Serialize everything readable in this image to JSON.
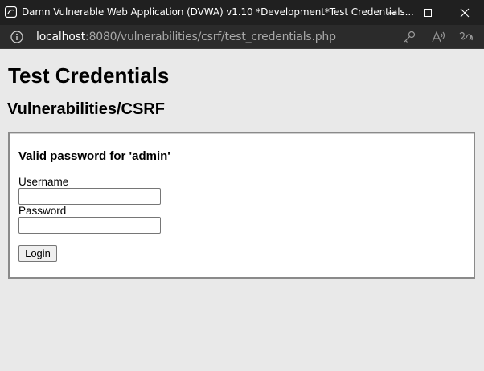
{
  "window": {
    "title": "Damn Vulnerable Web Application (DVWA) v1.10 *Development*Test Credentials...",
    "app_icon": "dvwa-app-icon",
    "controls": [
      "minimize-icon",
      "maximize-icon",
      "close-icon"
    ]
  },
  "address_bar": {
    "host": "localhost",
    "path": ":8080/vulnerabilities/csrf/test_credentials.php",
    "icons": [
      "info-icon",
      "key-icon",
      "read-aloud-icon",
      "translate-icon"
    ]
  },
  "page": {
    "title": "Test Credentials",
    "subtitle": "Vulnerabilities/CSRF",
    "message": "Valid password for 'admin'",
    "username_label": "Username",
    "username_value": "",
    "password_label": "Password",
    "password_value": "",
    "login_label": "Login"
  },
  "colors": {
    "titlebar_bg": "#202020",
    "addressbar_bg": "#2b2b2b",
    "page_bg": "#e9e9e9",
    "box_bg": "#ffffff"
  }
}
